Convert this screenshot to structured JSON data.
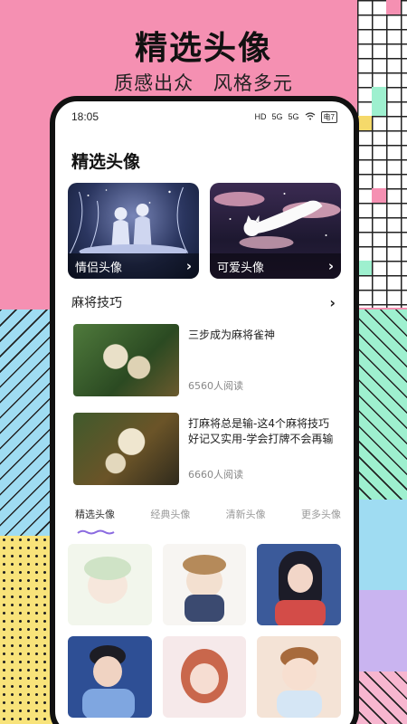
{
  "headline": "精选头像",
  "subline": "质感出众 风格多元",
  "status": {
    "time": "18:05",
    "icons": [
      "HD",
      "5G",
      "5G",
      "wifi-icon",
      "battery-icon"
    ],
    "battery": "电7"
  },
  "page_title": "精选头像",
  "cards": [
    {
      "label": "情侣头像"
    },
    {
      "label": "可爱头像"
    }
  ],
  "section": {
    "title": "麻将技巧"
  },
  "articles": [
    {
      "title": "三步成为麻将雀神",
      "reads": "6560人阅读"
    },
    {
      "title": "打麻将总是输-这4个麻将技巧好记又实用-学会打牌不会再输",
      "reads": "6660人阅读"
    }
  ],
  "tabs": [
    {
      "label": "精选头像",
      "active": true
    },
    {
      "label": "经典头像",
      "active": false
    },
    {
      "label": "清新头像",
      "active": false
    },
    {
      "label": "更多头像",
      "active": false
    }
  ],
  "colors": {
    "accent": "#8b6be0",
    "bg_pink": "#f590b2"
  }
}
